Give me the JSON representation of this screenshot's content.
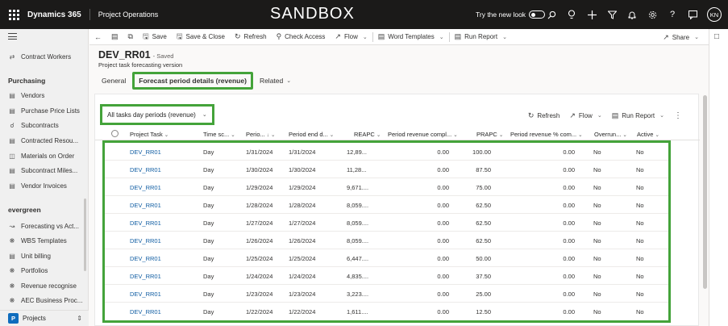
{
  "topbar": {
    "app_name": "Dynamics 365",
    "area": "Project Operations",
    "environment_banner": "SANDBOX",
    "try_new_look": "Try the new look",
    "avatar_initials": "KN"
  },
  "sidebar": {
    "items_top": [
      {
        "label": "Contract Workers",
        "icon": "contract-workers-icon"
      }
    ],
    "purchasing_header": "Purchasing",
    "purchasing_items": [
      {
        "label": "Vendors",
        "icon": "vendors-icon"
      },
      {
        "label": "Purchase Price Lists",
        "icon": "price-list-icon"
      },
      {
        "label": "Subcontracts",
        "icon": "subcontracts-icon"
      },
      {
        "label": "Contracted Resou...",
        "icon": "contracted-resources-icon"
      },
      {
        "label": "Materials on Order",
        "icon": "materials-icon"
      },
      {
        "label": "Subcontract Miles...",
        "icon": "milestones-icon"
      },
      {
        "label": "Vendor Invoices",
        "icon": "vendor-invoices-icon"
      }
    ],
    "evergreen_header": "evergreen",
    "evergreen_items": [
      {
        "label": "Forecasting vs Act...",
        "icon": "chart-icon"
      },
      {
        "label": "WBS Templates",
        "icon": "puzzle-icon"
      },
      {
        "label": "Unit billing",
        "icon": "document-icon"
      },
      {
        "label": "Portfolios",
        "icon": "puzzle-icon"
      },
      {
        "label": "Revenue recognise",
        "icon": "puzzle-icon"
      },
      {
        "label": "AEC Business Proc...",
        "icon": "puzzle-icon"
      }
    ],
    "area_badge": "P",
    "area_label": "Projects"
  },
  "commandbar": {
    "save": "Save",
    "save_close": "Save & Close",
    "refresh": "Refresh",
    "check_access": "Check Access",
    "flow": "Flow",
    "word_templates": "Word Templates",
    "run_report": "Run Report",
    "share": "Share"
  },
  "record": {
    "title": "DEV_RR01",
    "status": "- Saved",
    "entity": "Project task forecasting version"
  },
  "tabs": [
    {
      "label": "General"
    },
    {
      "label": "Forecast period details (revenue)"
    },
    {
      "label": "Related"
    }
  ],
  "grid": {
    "view_name": "All tasks day periods (revenue)",
    "refresh": "Refresh",
    "flow": "Flow",
    "run_report": "Run Report",
    "columns": [
      "Project Task",
      "Time sc...",
      "Perio...",
      "Period end d...",
      "REAPC",
      "Period revenue compl...",
      "PRAPC",
      "Period revenue % com...",
      "Overrun...",
      "Active"
    ],
    "rows": [
      [
        "DEV_RR01",
        "Day",
        "1/31/2024",
        "1/31/2024",
        "12,89...",
        "0.00",
        "100.00",
        "0.00",
        "No",
        "No"
      ],
      [
        "DEV_RR01",
        "Day",
        "1/30/2024",
        "1/30/2024",
        "11,28...",
        "0.00",
        "87.50",
        "0.00",
        "No",
        "No"
      ],
      [
        "DEV_RR01",
        "Day",
        "1/29/2024",
        "1/29/2024",
        "9,671....",
        "0.00",
        "75.00",
        "0.00",
        "No",
        "No"
      ],
      [
        "DEV_RR01",
        "Day",
        "1/28/2024",
        "1/28/2024",
        "8,059....",
        "0.00",
        "62.50",
        "0.00",
        "No",
        "No"
      ],
      [
        "DEV_RR01",
        "Day",
        "1/27/2024",
        "1/27/2024",
        "8,059....",
        "0.00",
        "62.50",
        "0.00",
        "No",
        "No"
      ],
      [
        "DEV_RR01",
        "Day",
        "1/26/2024",
        "1/26/2024",
        "8,059....",
        "0.00",
        "62.50",
        "0.00",
        "No",
        "No"
      ],
      [
        "DEV_RR01",
        "Day",
        "1/25/2024",
        "1/25/2024",
        "6,447....",
        "0.00",
        "50.00",
        "0.00",
        "No",
        "No"
      ],
      [
        "DEV_RR01",
        "Day",
        "1/24/2024",
        "1/24/2024",
        "4,835....",
        "0.00",
        "37.50",
        "0.00",
        "No",
        "No"
      ],
      [
        "DEV_RR01",
        "Day",
        "1/23/2024",
        "1/23/2024",
        "3,223....",
        "0.00",
        "25.00",
        "0.00",
        "No",
        "No"
      ],
      [
        "DEV_RR01",
        "Day",
        "1/22/2024",
        "1/22/2024",
        "1,611....",
        "0.00",
        "12.50",
        "0.00",
        "No",
        "No"
      ]
    ]
  },
  "colors": {
    "topbar_bg": "#1b1a19",
    "highlight_green": "#44a33a",
    "link_blue": "#115ea3",
    "area_badge": "#0f6cbd"
  }
}
